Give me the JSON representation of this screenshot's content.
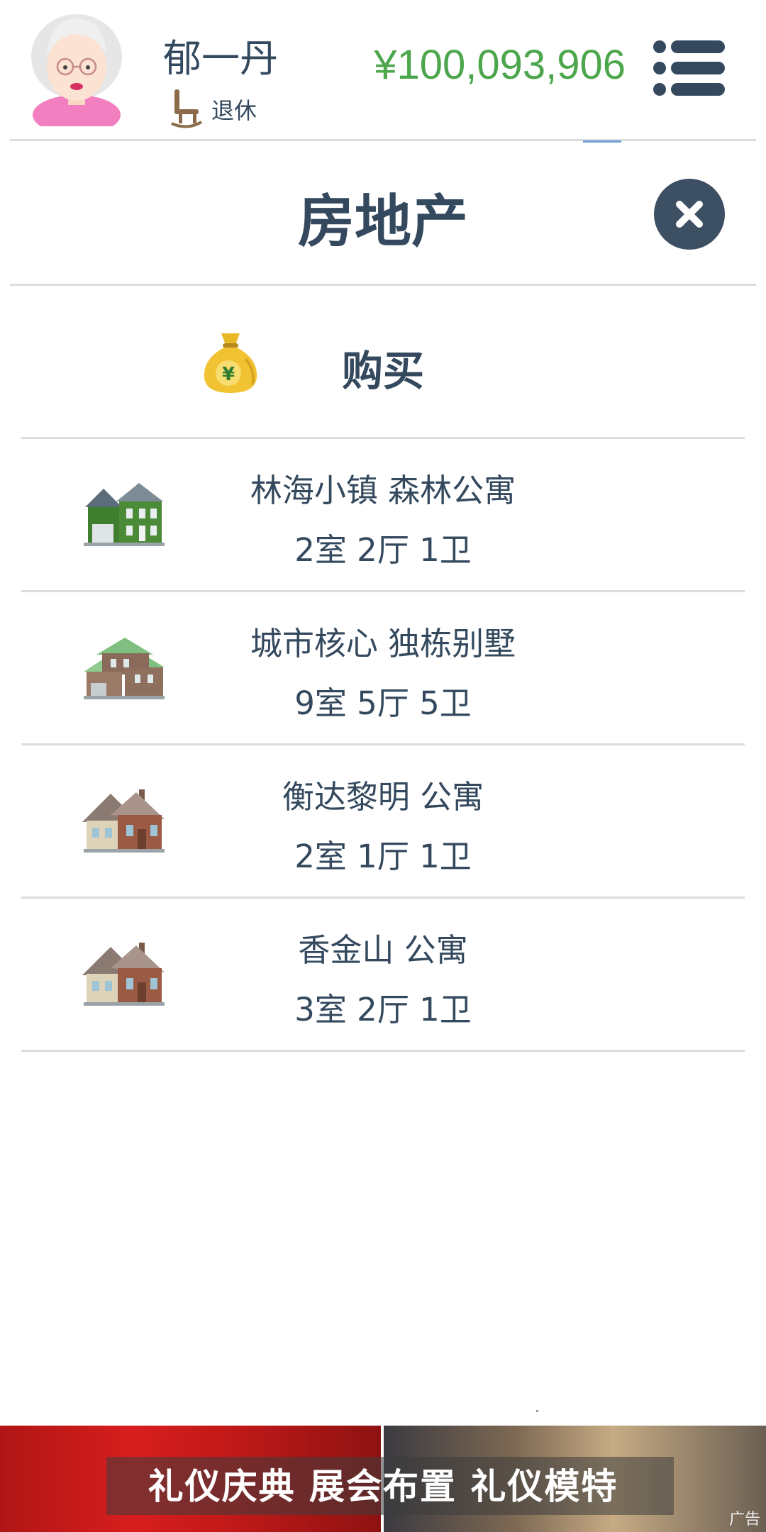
{
  "header": {
    "player_name": "郁一丹",
    "status": "退休",
    "money": "¥100,093,906"
  },
  "panel": {
    "title": "房地产",
    "buy_label": "购买"
  },
  "properties": [
    {
      "name": "林海小镇 森林公寓",
      "rooms": "2室 2厅 1卫",
      "icon": "green-house-icon"
    },
    {
      "name": "城市核心 独栋别墅",
      "rooms": "9室 5厅 5卫",
      "icon": "villa-icon"
    },
    {
      "name": "衡达黎明 公寓",
      "rooms": "2室 1厅 1卫",
      "icon": "brick-house-icon"
    },
    {
      "name": "香金山 公寓",
      "rooms": "3室 2厅 1卫",
      "icon": "brick-house-icon"
    }
  ],
  "ad": {
    "text": "礼仪庆典  展会布置  礼仪模特",
    "tag": "广告"
  },
  "colors": {
    "text": "#34495e",
    "money": "#4ca64c",
    "divider": "#d9dde0",
    "close_button": "#3d4f63"
  }
}
